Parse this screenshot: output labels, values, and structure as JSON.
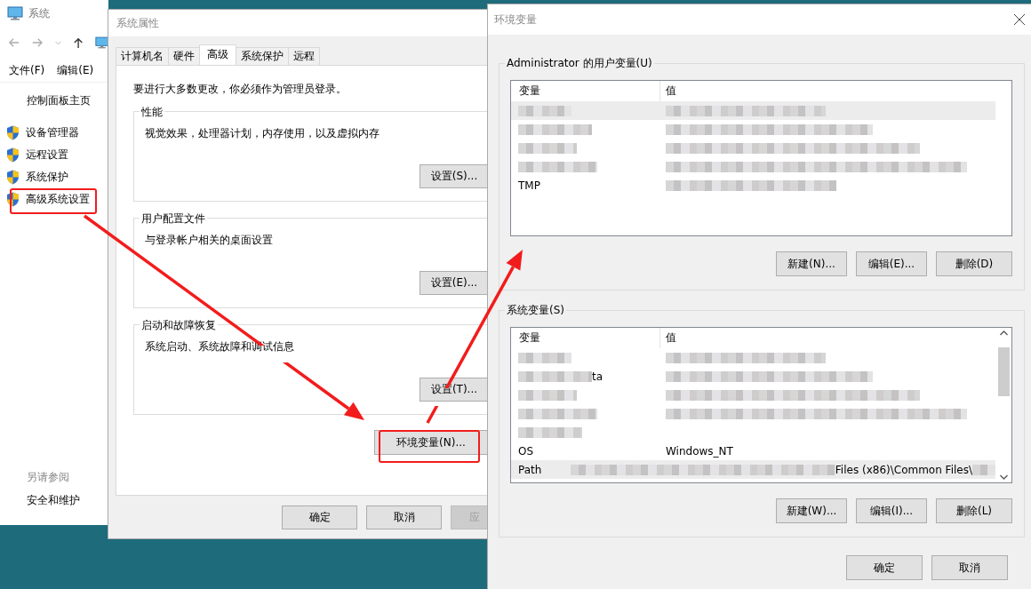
{
  "system_window": {
    "title": "系统",
    "menu": [
      "文件(F)",
      "编辑(E)"
    ],
    "sidebar": {
      "home": "控制面板主页",
      "items": [
        {
          "label": "设备管理器",
          "highlighted": false
        },
        {
          "label": "远程设置",
          "highlighted": false
        },
        {
          "label": "系统保护",
          "highlighted": false
        },
        {
          "label": "高级系统设置",
          "highlighted": true
        }
      ]
    },
    "see_also": {
      "heading": "另请参阅",
      "links": [
        "安全和维护"
      ]
    }
  },
  "properties_window": {
    "title": "系统属性",
    "tabs": [
      {
        "label": "计算机名",
        "selected": false
      },
      {
        "label": "硬件",
        "selected": false
      },
      {
        "label": "高级",
        "selected": true
      },
      {
        "label": "系统保护",
        "selected": false
      },
      {
        "label": "远程",
        "selected": false
      }
    ],
    "notice": "要进行大多数更改，你必须作为管理员登录。",
    "groups": [
      {
        "title": "性能",
        "description": "视觉效果，处理器计划，内存使用，以及虚拟内存",
        "button": "设置(S)..."
      },
      {
        "title": "用户配置文件",
        "description": "与登录帐户相关的桌面设置",
        "button": "设置(E)..."
      },
      {
        "title": "启动和故障恢复",
        "description": "系统启动、系统故障和调试信息",
        "button": "设置(T)..."
      }
    ],
    "env_button": {
      "label": "环境变量(N)...",
      "highlighted": true
    },
    "buttons": [
      {
        "label": "确定",
        "disabled": false
      },
      {
        "label": "取消",
        "disabled": false
      },
      {
        "label": "应",
        "disabled": true
      }
    ]
  },
  "env_window": {
    "title": "环境变量",
    "user_vars": {
      "title": "Administrator 的用户变量(U)",
      "columns": [
        "变量",
        "值"
      ],
      "rows": [
        {
          "selected": true,
          "variable": [
            {
              "kind": "blur"
            }
          ],
          "value": [
            {
              "kind": "blur"
            }
          ]
        },
        {
          "selected": false,
          "variable": [
            {
              "kind": "blur"
            }
          ],
          "value": [
            {
              "kind": "blur"
            }
          ]
        },
        {
          "selected": false,
          "variable": [
            {
              "kind": "blur"
            }
          ],
          "value": [
            {
              "kind": "blur"
            }
          ]
        },
        {
          "selected": false,
          "variable": [
            {
              "kind": "blur"
            }
          ],
          "value": [
            {
              "kind": "blur"
            }
          ]
        },
        {
          "selected": false,
          "variable": [
            {
              "kind": "text",
              "text": "TMP"
            }
          ],
          "value": [
            {
              "kind": "blur"
            }
          ]
        }
      ],
      "buttons": [
        "新建(N)...",
        "编辑(E)...",
        "删除(D)"
      ]
    },
    "system_vars": {
      "title": "系统变量(S)",
      "columns": [
        "变量",
        "值"
      ],
      "rows": [
        {
          "selected": false,
          "variable": [
            {
              "kind": "blur"
            }
          ],
          "value": [
            {
              "kind": "blur"
            }
          ]
        },
        {
          "selected": false,
          "variable": [
            {
              "kind": "blur"
            },
            {
              "kind": "text",
              "text": "ta"
            }
          ],
          "value": [
            {
              "kind": "blur"
            }
          ]
        },
        {
          "selected": false,
          "variable": [
            {
              "kind": "blur"
            }
          ],
          "value": [
            {
              "kind": "blur"
            }
          ]
        },
        {
          "selected": false,
          "variable": [
            {
              "kind": "blur"
            }
          ],
          "value": [
            {
              "kind": "blur"
            }
          ]
        },
        {
          "selected": false,
          "variable": [
            {
              "kind": "blur"
            }
          ]
        },
        {
          "selected": false,
          "variable": [
            {
              "kind": "text",
              "text": "OS"
            }
          ],
          "value": [
            {
              "kind": "text",
              "text": "Windows_NT"
            }
          ]
        },
        {
          "selected": true,
          "variable": [
            {
              "kind": "text",
              "text": "Path"
            }
          ],
          "value": [
            {
              "kind": "blur"
            },
            {
              "kind": "text",
              "text": "Files (x86)\\Common Files\\"
            },
            {
              "kind": "blur"
            }
          ]
        }
      ],
      "buttons": [
        "新建(W)...",
        "编辑(I)...",
        "删除(L)"
      ]
    },
    "buttons": [
      "确定",
      "取消"
    ]
  },
  "annotations": [
    {
      "kind": "arrow"
    },
    {
      "kind": "arrow"
    }
  ]
}
